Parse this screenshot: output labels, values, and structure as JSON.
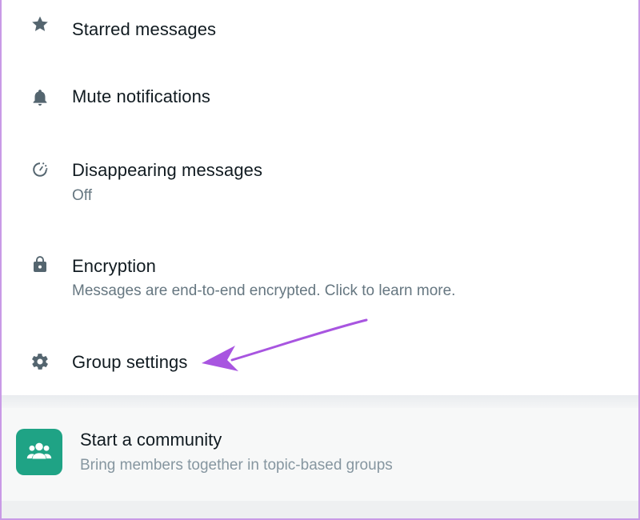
{
  "items": [
    {
      "title": "Starred messages",
      "icon": "star-icon"
    },
    {
      "title": "Mute notifications",
      "icon": "bell-icon"
    },
    {
      "title": "Disappearing messages",
      "subtitle": "Off",
      "icon": "timer-icon"
    },
    {
      "title": "Encryption",
      "subtitle": "Messages are end-to-end encrypted. Click to learn more.",
      "icon": "lock-icon"
    },
    {
      "title": "Group settings",
      "icon": "gear-icon"
    }
  ],
  "community": {
    "title": "Start a community",
    "subtitle": "Bring members together in topic-based groups",
    "icon": "community-group-icon"
  },
  "colors": {
    "accent_green": "#1fa385",
    "annotation_arrow": "#a855e0",
    "icon_gray": "#54656f",
    "text_primary": "#111b21",
    "text_secondary": "#667781"
  }
}
